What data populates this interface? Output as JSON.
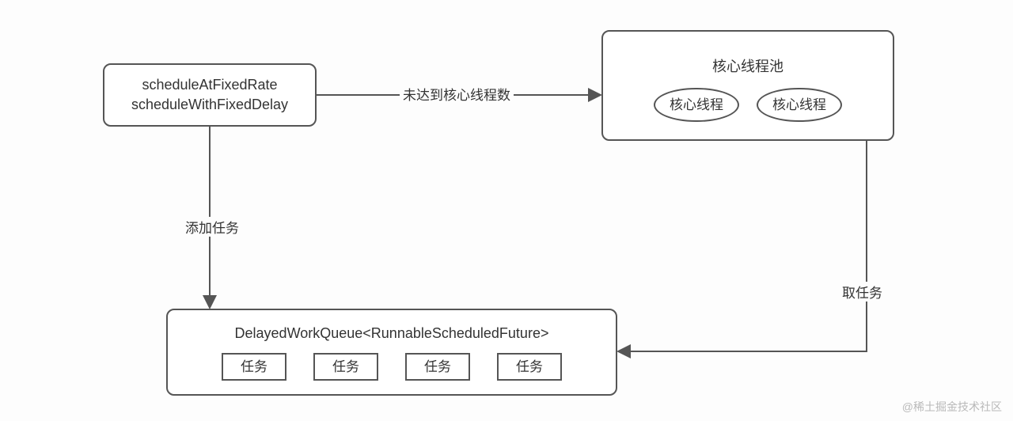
{
  "nodes": {
    "schedule": {
      "line1": "scheduleAtFixedRate",
      "line2": "scheduleWithFixedDelay"
    },
    "pool": {
      "title": "核心线程池",
      "thread1": "核心线程",
      "thread2": "核心线程"
    },
    "queue": {
      "title": "DelayedWorkQueue<RunnableScheduledFuture>",
      "task1": "任务",
      "task2": "任务",
      "task3": "任务",
      "task4": "任务"
    }
  },
  "edges": {
    "toPool": "未达到核心线程数",
    "toQueue": "添加任务",
    "fromPool": "取任务"
  },
  "watermark": "@稀土掘金技术社区"
}
